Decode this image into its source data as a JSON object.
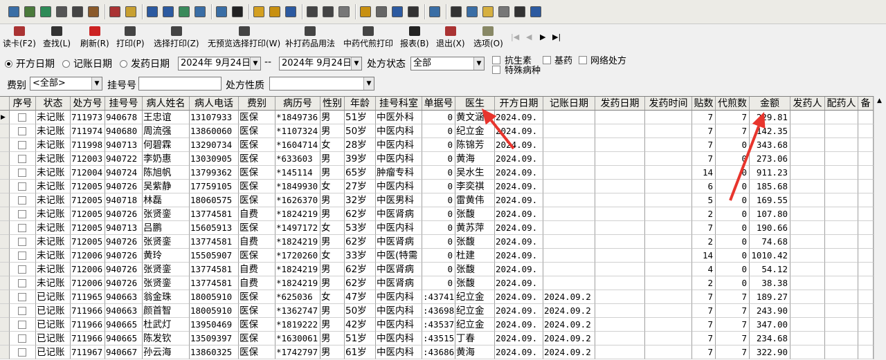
{
  "toolbar2": {
    "buttons": [
      "读卡(F2)",
      "查找(L)",
      "刷新(R)",
      "打印(P)",
      "选择打印(Z)",
      "无预览选择打印(W)",
      "补打药品用法",
      "中药代煎打印",
      "报表(B)",
      "退出(X)",
      "选项(O)"
    ],
    "nav": [
      "|◀",
      "◀",
      "▶",
      "▶|"
    ]
  },
  "filters": {
    "date_radios": [
      "开方日期",
      "记账日期",
      "发药日期"
    ],
    "date_from": "2024年 9月24日",
    "date_sep": "--",
    "date_to": "2024年 9月24日",
    "status_label": "处方状态",
    "status_value": "全部",
    "checkboxes": [
      "抗生素",
      "基药",
      "网络处方",
      "特殊病种"
    ],
    "fee_label": "费别",
    "fee_value": "<全部>",
    "reg_label": "挂号号",
    "reg_value": "",
    "nature_label": "处方性质",
    "nature_value": ""
  },
  "grid": {
    "columns": [
      "序号",
      "状态",
      "处方号",
      "挂号号",
      "病人姓名",
      "病人电话",
      "费别",
      "病历号",
      "性别",
      "年龄",
      "挂号科室",
      "单据号",
      "医生",
      "开方日期",
      "记账日期",
      "发药日期",
      "发药时间",
      "贴数",
      "代煎数",
      "金额",
      "发药人",
      "配药人",
      "备"
    ],
    "rows": [
      [
        "",
        "未记账",
        "711973",
        "940678",
        "王忠谊",
        "13107933",
        "医保",
        "*1849736",
        "男",
        "51岁",
        "中医外科",
        "0",
        "黄文涵",
        "2024.09.",
        "",
        "",
        "",
        "7",
        "7",
        "229.81"
      ],
      [
        "",
        "未记账",
        "711974",
        "940680",
        "周流强",
        "13860060",
        "医保",
        "*1107324",
        "男",
        "50岁",
        "中医内科",
        "0",
        "纪立金",
        "2024.09.",
        "",
        "",
        "",
        "7",
        "7",
        "142.35"
      ],
      [
        "",
        "未记账",
        "711998",
        "940713",
        "何碧霖",
        "13290734",
        "医保",
        "*1604714",
        "女",
        "28岁",
        "中医内科",
        "0",
        "陈锦芳",
        "2024.09.",
        "",
        "",
        "",
        "7",
        "0",
        "343.68"
      ],
      [
        "",
        "未记账",
        "712003",
        "940722",
        "李奶惠",
        "13030905",
        "医保",
        "*633603",
        "男",
        "39岁",
        "中医内科",
        "0",
        "黄海",
        "2024.09.",
        "",
        "",
        "",
        "7",
        "0",
        "273.06"
      ],
      [
        "",
        "未记账",
        "712004",
        "940724",
        "陈旭帆",
        "13799362",
        "医保",
        "*145114",
        "男",
        "65岁",
        "肿瘤专科",
        "0",
        "吴水生",
        "2024.09.",
        "",
        "",
        "",
        "14",
        "0",
        "911.23"
      ],
      [
        "",
        "未记账",
        "712005",
        "940726",
        "吴紫静",
        "17759105",
        "医保",
        "*1849930",
        "女",
        "27岁",
        "中医内科",
        "0",
        "李奕祺",
        "2024.09.",
        "",
        "",
        "",
        "6",
        "0",
        "185.68"
      ],
      [
        "",
        "未记账",
        "712005",
        "940718",
        "林磊",
        "18060575",
        "医保",
        "*1626370",
        "男",
        "32岁",
        "中医男科",
        "0",
        "雷黄伟",
        "2024.09.",
        "",
        "",
        "",
        "5",
        "0",
        "169.55"
      ],
      [
        "",
        "未记账",
        "712005",
        "940726",
        "张贤銮",
        "13774581",
        "自费",
        "*1824219",
        "男",
        "62岁",
        "中医肾病",
        "0",
        "张馥",
        "2024.09.",
        "",
        "",
        "",
        "2",
        "0",
        "107.80"
      ],
      [
        "",
        "未记账",
        "712005",
        "940713",
        "吕鹏",
        "15605913",
        "医保",
        "*1497172",
        "女",
        "53岁",
        "中医内科",
        "0",
        "黄苏萍",
        "2024.09.",
        "",
        "",
        "",
        "7",
        "0",
        "190.66"
      ],
      [
        "",
        "未记账",
        "712005",
        "940726",
        "张贤銮",
        "13774581",
        "自费",
        "*1824219",
        "男",
        "62岁",
        "中医肾病",
        "0",
        "张馥",
        "2024.09.",
        "",
        "",
        "",
        "2",
        "0",
        "74.68"
      ],
      [
        "",
        "未记账",
        "712006",
        "940726",
        "黄玲",
        "15505907",
        "医保",
        "*1720260",
        "女",
        "33岁",
        "中医(特需",
        "0",
        "杜建",
        "2024.09.",
        "",
        "",
        "",
        "14",
        "0",
        "1010.42"
      ],
      [
        "",
        "未记账",
        "712006",
        "940726",
        "张贤銮",
        "13774581",
        "自费",
        "*1824219",
        "男",
        "62岁",
        "中医肾病",
        "0",
        "张馥",
        "2024.09.",
        "",
        "",
        "",
        "4",
        "0",
        "54.12"
      ],
      [
        "",
        "未记账",
        "712006",
        "940726",
        "张贤銮",
        "13774581",
        "自费",
        "*1824219",
        "男",
        "62岁",
        "中医肾病",
        "0",
        "张馥",
        "2024.09.",
        "",
        "",
        "",
        "2",
        "0",
        "38.38"
      ],
      [
        "",
        "已记账",
        "711965",
        "940663",
        "翁金珠",
        "18005910",
        "医保",
        "*625036",
        "女",
        "47岁",
        "中医内科",
        ":43741",
        "纪立金",
        "2024.09.",
        "2024.09.2",
        "",
        "",
        "7",
        "7",
        "189.27"
      ],
      [
        "",
        "已记账",
        "711966",
        "940663",
        "颜首智",
        "18005910",
        "医保",
        "*1362747",
        "男",
        "50岁",
        "中医内科",
        ":43698",
        "纪立金",
        "2024.09.",
        "2024.09.2",
        "",
        "",
        "7",
        "7",
        "243.90"
      ],
      [
        "",
        "已记账",
        "711966",
        "940665",
        "杜武灯",
        "13950469",
        "医保",
        "*1819222",
        "男",
        "42岁",
        "中医内科",
        ":43537",
        "纪立金",
        "2024.09.",
        "2024.09.2",
        "",
        "",
        "7",
        "7",
        "347.00"
      ],
      [
        "",
        "已记账",
        "711966",
        "940665",
        "陈发钦",
        "13509397",
        "医保",
        "*1630061",
        "男",
        "51岁",
        "中医内科",
        ":43515",
        "丁春",
        "2024.09.",
        "2024.09.2",
        "",
        "",
        "7",
        "7",
        "234.68"
      ],
      [
        "",
        "已记账",
        "711967",
        "940667",
        "孙云海",
        "13860325",
        "医保",
        "*1742797",
        "男",
        "61岁",
        "中医内科",
        ":43686",
        "黄海",
        "2024.09.",
        "2024.09.2",
        "",
        "",
        "7",
        "7",
        "322.90"
      ]
    ]
  },
  "annotation_color": "#e8352d"
}
